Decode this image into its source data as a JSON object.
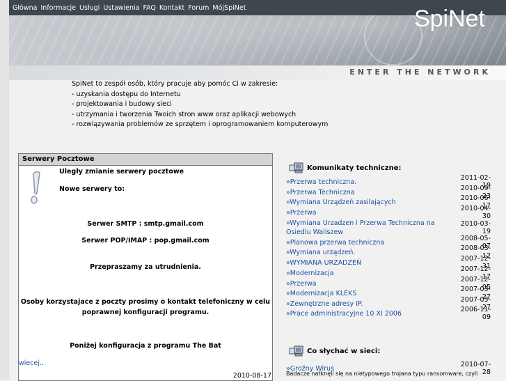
{
  "nav": [
    "Główna",
    "Informacje",
    "Usługi",
    "Ustawienia",
    "FAQ",
    "Kontakt",
    "Forum",
    "MójSpiNet"
  ],
  "logo": "SpiNet",
  "tagline": "ENTER THE NETWORK",
  "intro": {
    "heading": "SpiNet to zespół osób, który pracuje aby pomóc Ci w zakresie:",
    "items": [
      "- uzyskania dostępu do Internetu",
      "- projektowania i budowy sieci",
      "- utrzymania i tworzenia Twoich stron www oraz aplikacji webowych",
      "- rozwiązywania problemów ze sprzętem i oprogramowaniem komputerowym"
    ]
  },
  "mailbox": {
    "title": "Serwery Pocztowe",
    "line1": "Uległy zmianie serwery pocztowe",
    "line2": "Nowe serwery to:",
    "smtp": "Serwer SMTP : smtp.gmail.com",
    "pop": "Serwer POP/IMAP : pop.gmail.com",
    "apology": "Przepraszamy za utrudnienia.",
    "contact1": "Osoby korzystajace z poczty prosimy o kontakt telefoniczny w celu",
    "contact2": "poprawnej konfiguracji programu.",
    "config": "Poniżej konfiguracja z programu The Bat",
    "more": "wiecej..",
    "date": "2010-08-17"
  },
  "tech": {
    "title": "Komunikaty techniczne:",
    "items": [
      {
        "label": "»Przerwa techniczna.",
        "date": "2011-02-19"
      },
      {
        "label": "»Przerwa Techniczna",
        "date": "2010-09-23"
      },
      {
        "label": "»Wymiana Urządzeń zasilających",
        "date": "2010-06-17"
      },
      {
        "label": "»Przerwa",
        "date": "2010-04-30"
      },
      {
        "label": "»Wymiana Urzadzen i Przerwa Techniczna na Osiedlu Waliszew",
        "date": "2010-03-19"
      },
      {
        "label": "»Planowa przerwa techniczna",
        "date": "2008-05-07"
      },
      {
        "label": "»Wymiana urządzeń.",
        "date": "2008-03-12"
      },
      {
        "label": "»WYMIANA URZADZEŃ",
        "date": "2007-12-31"
      },
      {
        "label": "»Modernizacja",
        "date": "2007-12-17"
      },
      {
        "label": "»Przerwa",
        "date": "2007-12-05"
      },
      {
        "label": "»Modernizacja KLEKS",
        "date": "2007-03-27"
      },
      {
        "label": "»Zewnętrzne adresy IP.",
        "date": "2007-03-27"
      },
      {
        "label": "»Prace administracyjne 10 XI 2006",
        "date": "2006-11-09"
      }
    ]
  },
  "news": {
    "title": "Co słychać w sieci:",
    "items": [
      {
        "label": "»Groźny Wirus",
        "date": "2010-07-28",
        "desc": "Badacze natknęli się na nietypowego trojana typu ransomware, czyli"
      }
    ]
  }
}
